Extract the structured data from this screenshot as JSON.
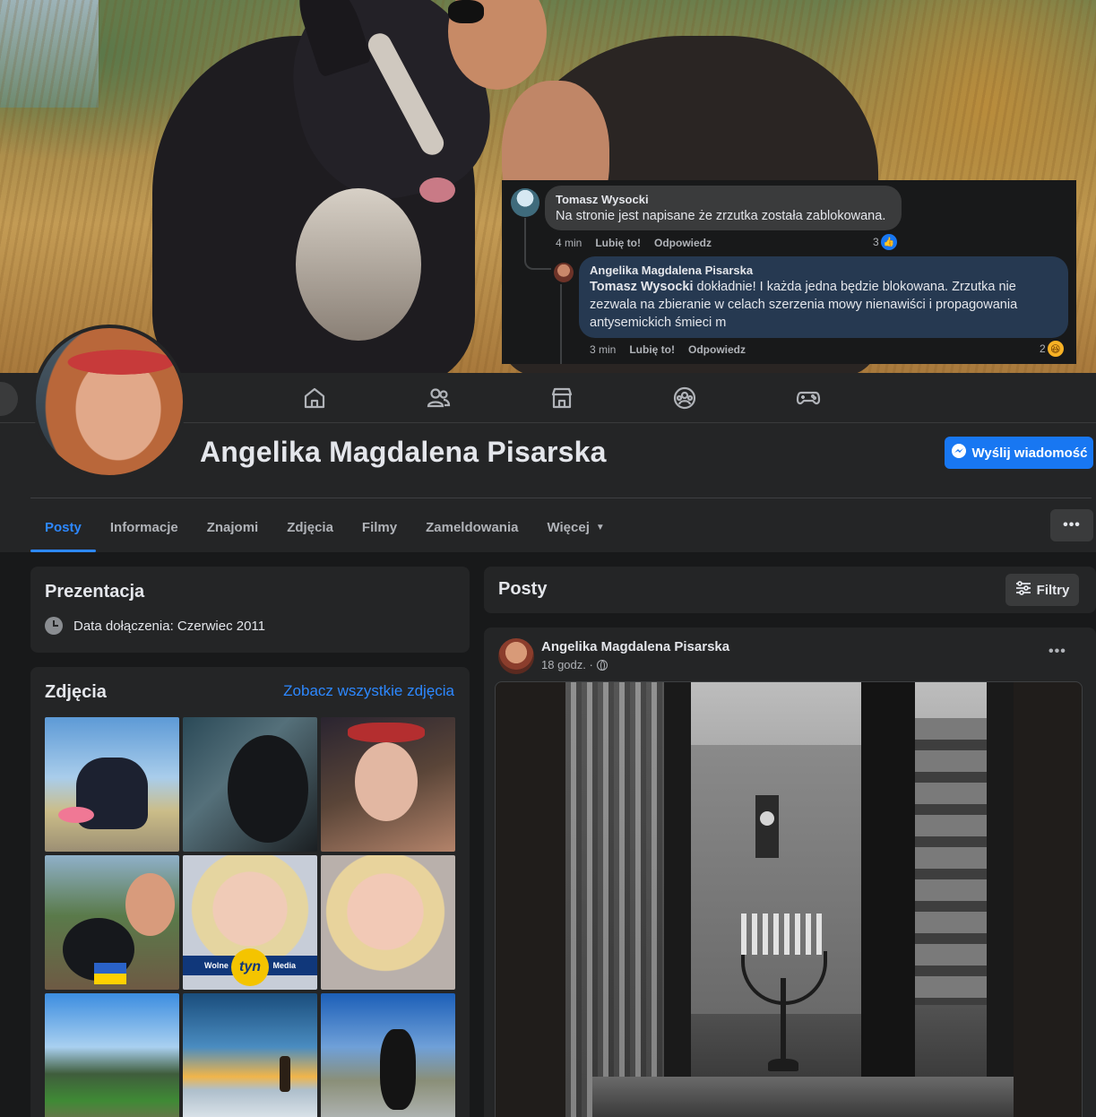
{
  "comments": [
    {
      "author": "Tomasz Wysocki",
      "text": "Na stronie jest napisane że zrzutka została zablokowana.",
      "time": "4 min",
      "like_label": "Lubię to!",
      "reply_label": "Odpowiedz",
      "reaction_count": "3",
      "reaction": "like-icon"
    },
    {
      "author": "Angelika Magdalena Pisarska",
      "mention": "Tomasz Wysocki",
      "text": " dokładnie! I każda jedna będzie blokowana. Zrzutka nie zezwala na zbieranie w celach szerzenia mowy nienawiści i propagowania antysemickich śmieci m",
      "time": "3 min",
      "like_label": "Lubię to!",
      "reply_label": "Odpowiedz",
      "reaction_count": "2",
      "reaction": "haha-icon"
    }
  ],
  "nav": {
    "icons": [
      "home-icon",
      "friends-icon",
      "marketplace-icon",
      "groups-icon",
      "gaming-icon"
    ]
  },
  "profile": {
    "name": "Angelika Magdalena Pisarska",
    "message_button": "Wyślij wiadomość",
    "tabs": [
      "Posty",
      "Informacje",
      "Znajomi",
      "Zdjęcia",
      "Filmy",
      "Zameldowania",
      "Więcej"
    ],
    "active_tab": "Posty",
    "more_button": "•••"
  },
  "intro": {
    "title": "Prezentacja",
    "joined": "Data dołączenia: Czerwiec 2011"
  },
  "photos": {
    "title": "Zdjęcia",
    "see_all": "Zobacz wszystkie zdjęcia",
    "badge_left": "Wolne",
    "badge_center": "tyn",
    "badge_right": "Media"
  },
  "posts": {
    "title": "Posty",
    "filter": "Filtry",
    "post": {
      "author": "Angelika Magdalena Pisarska",
      "time": "18 godz. ·",
      "more": "•••"
    }
  },
  "colors": {
    "accent": "#2d88ff",
    "button_blue": "#1877f2",
    "card_bg": "#242526",
    "page_bg": "#18191a"
  }
}
